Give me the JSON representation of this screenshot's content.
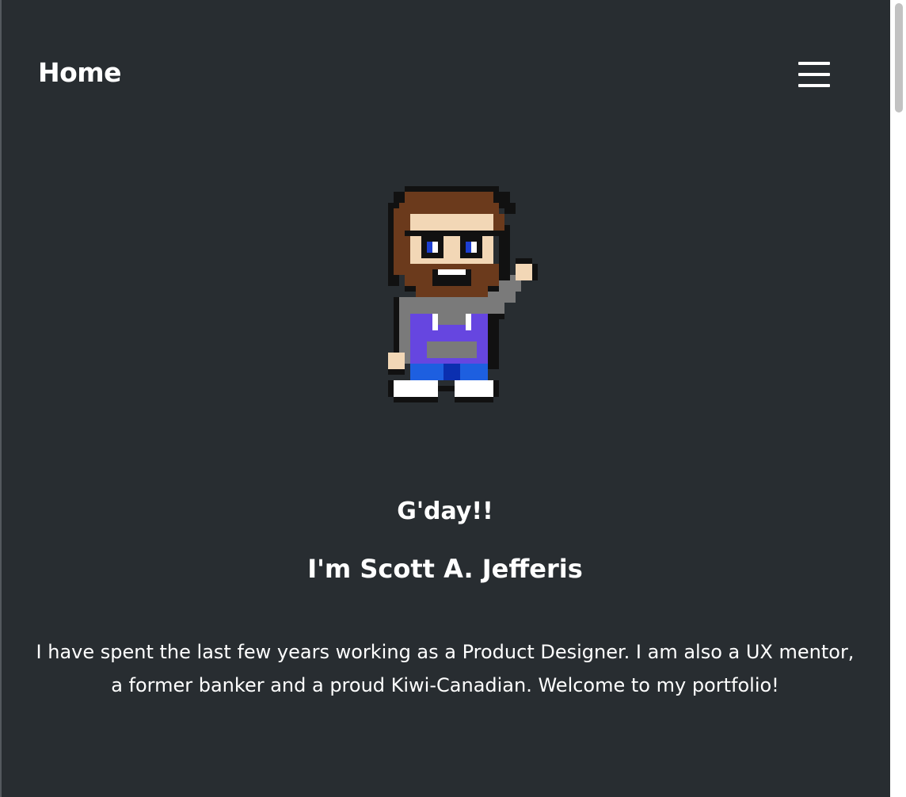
{
  "nav": {
    "home_label": "Home",
    "menu_icon": "hamburger-menu-icon"
  },
  "hero": {
    "avatar": "pixel-art-avatar",
    "greeting": "G'day!!",
    "name": "I'm Scott A. Jefferis",
    "intro": "I have spent the last few years working as a Product Designer. I am also a UX mentor, a former banker and a proud Kiwi-Canadian. Welcome to my portfolio!"
  },
  "colors": {
    "background": "#282d31",
    "text": "#ffffff"
  }
}
